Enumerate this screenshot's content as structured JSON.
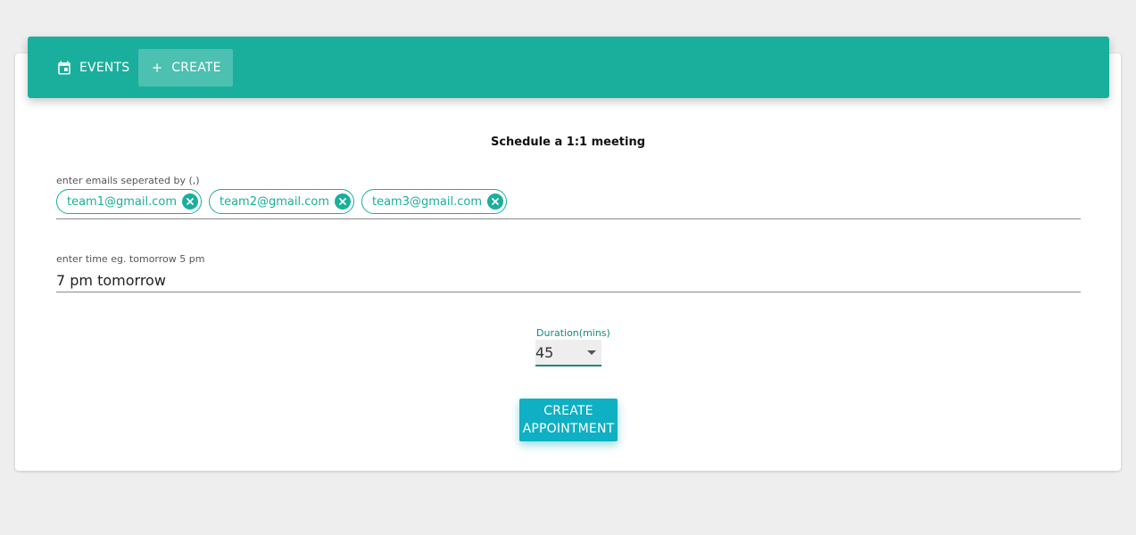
{
  "colors": {
    "primary": "#1aaf9c",
    "button": "#0fb0c3",
    "background": "#eeeeee",
    "card": "#ffffff"
  },
  "toolbar": {
    "events": {
      "label": "EVENTS",
      "icon": "calendar-icon"
    },
    "create": {
      "label": "CREATE",
      "icon": "plus-icon"
    }
  },
  "form": {
    "title": "Schedule a 1:1 meeting",
    "emails": {
      "label": "enter emails seperated by (,)",
      "chips": [
        "team1@gmail.com",
        "team2@gmail.com",
        "team3@gmail.com"
      ]
    },
    "time": {
      "label": "enter time eg. tomorrow 5 pm",
      "value": "7 pm tomorrow"
    },
    "duration": {
      "label": "Duration(mins)",
      "value": "45"
    },
    "submit": {
      "line1": "CREATE",
      "line2": "APPOINTMENT"
    }
  }
}
